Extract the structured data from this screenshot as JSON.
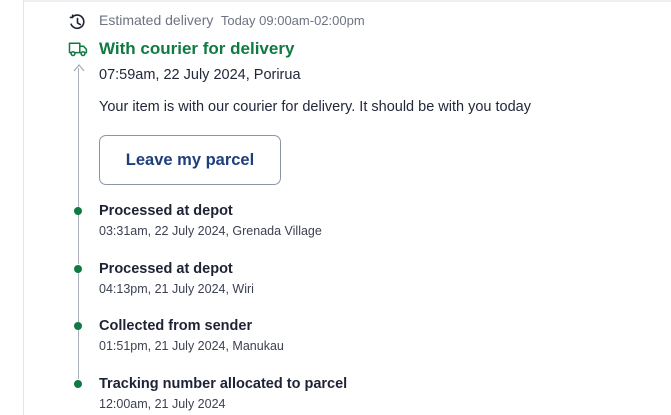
{
  "colors": {
    "accent_green": "#0f7a42",
    "button_text": "#1f3e7c",
    "rail": "#a8aeba"
  },
  "estimated": {
    "icon": "clock-icon",
    "label": "Estimated delivery",
    "value": "Today 09:00am-02:00pm"
  },
  "current": {
    "icon": "delivery-van-icon",
    "title": "With courier for delivery",
    "time": "07:59am, 22 July 2024, Porirua",
    "message": "Your item is with our courier for delivery. It should be with you today",
    "button_label": "Leave my parcel"
  },
  "events": [
    {
      "title": "Processed at depot",
      "detail": "03:31am, 22 July 2024, Grenada Village"
    },
    {
      "title": "Processed at depot",
      "detail": "04:13pm, 21 July 2024, Wiri"
    },
    {
      "title": "Collected from sender",
      "detail": "01:51pm, 21 July 2024, Manukau"
    },
    {
      "title": "Tracking number allocated to parcel",
      "detail": "12:00am, 21 July 2024"
    }
  ]
}
